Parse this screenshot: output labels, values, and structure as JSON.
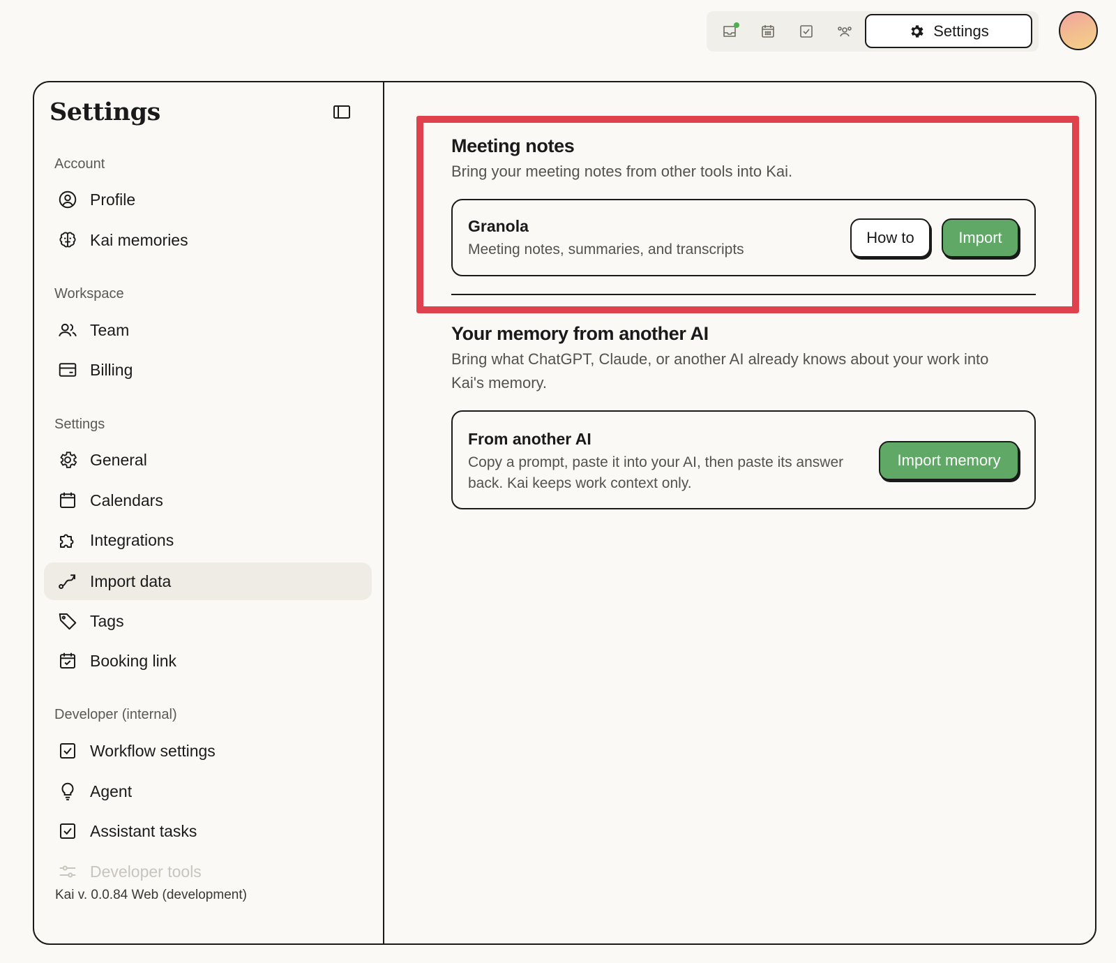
{
  "topbar": {
    "icons": [
      "inbox-icon",
      "calendar-icon",
      "tasks-icon",
      "people-icon"
    ],
    "settings_label": "Settings",
    "notification_color": "#4caf50"
  },
  "sidebar": {
    "title": "Settings",
    "sections": [
      {
        "label": "Account",
        "items": [
          {
            "label": "Profile",
            "icon": "user-circle-icon"
          },
          {
            "label": "Kai memories",
            "icon": "brain-icon"
          }
        ]
      },
      {
        "label": "Workspace",
        "items": [
          {
            "label": "Team",
            "icon": "people-icon"
          },
          {
            "label": "Billing",
            "icon": "credit-card-icon"
          }
        ]
      },
      {
        "label": "Settings",
        "items": [
          {
            "label": "General",
            "icon": "gear-icon"
          },
          {
            "label": "Calendars",
            "icon": "calendar-icon"
          },
          {
            "label": "Integrations",
            "icon": "puzzle-icon"
          },
          {
            "label": "Import data",
            "icon": "route-icon",
            "active": true
          },
          {
            "label": "Tags",
            "icon": "tag-icon"
          },
          {
            "label": "Booking link",
            "icon": "calendar-check-icon"
          }
        ]
      },
      {
        "label": "Developer (internal)",
        "items": [
          {
            "label": "Workflow settings",
            "icon": "checkbox-icon"
          },
          {
            "label": "Agent",
            "icon": "lightbulb-icon"
          },
          {
            "label": "Assistant tasks",
            "icon": "checkbox-icon"
          },
          {
            "label": "Developer tools",
            "icon": "sliders-icon"
          }
        ]
      }
    ],
    "version": "Kai v. 0.0.84 Web (development)"
  },
  "main": {
    "meeting_notes": {
      "title": "Meeting notes",
      "description": "Bring your meeting notes from other tools into Kai.",
      "card": {
        "title": "Granola",
        "description": "Meeting notes, summaries, and transcripts",
        "how_to_label": "How to",
        "import_label": "Import"
      }
    },
    "memory": {
      "title": "Your memory from another AI",
      "description_line1": "Bring what ChatGPT, Claude, or another AI already knows about your work into",
      "description_line2": "Kai's memory.",
      "card": {
        "title": "From another AI",
        "description_line1": "Copy a prompt, paste it into your AI, then paste its answer",
        "description_line2": "back. Kai keeps work context only.",
        "import_label": "Import memory"
      }
    }
  },
  "colors": {
    "accent_green": "#5fa866",
    "highlight_red": "#e0424d",
    "active_bg": "#efece5"
  }
}
